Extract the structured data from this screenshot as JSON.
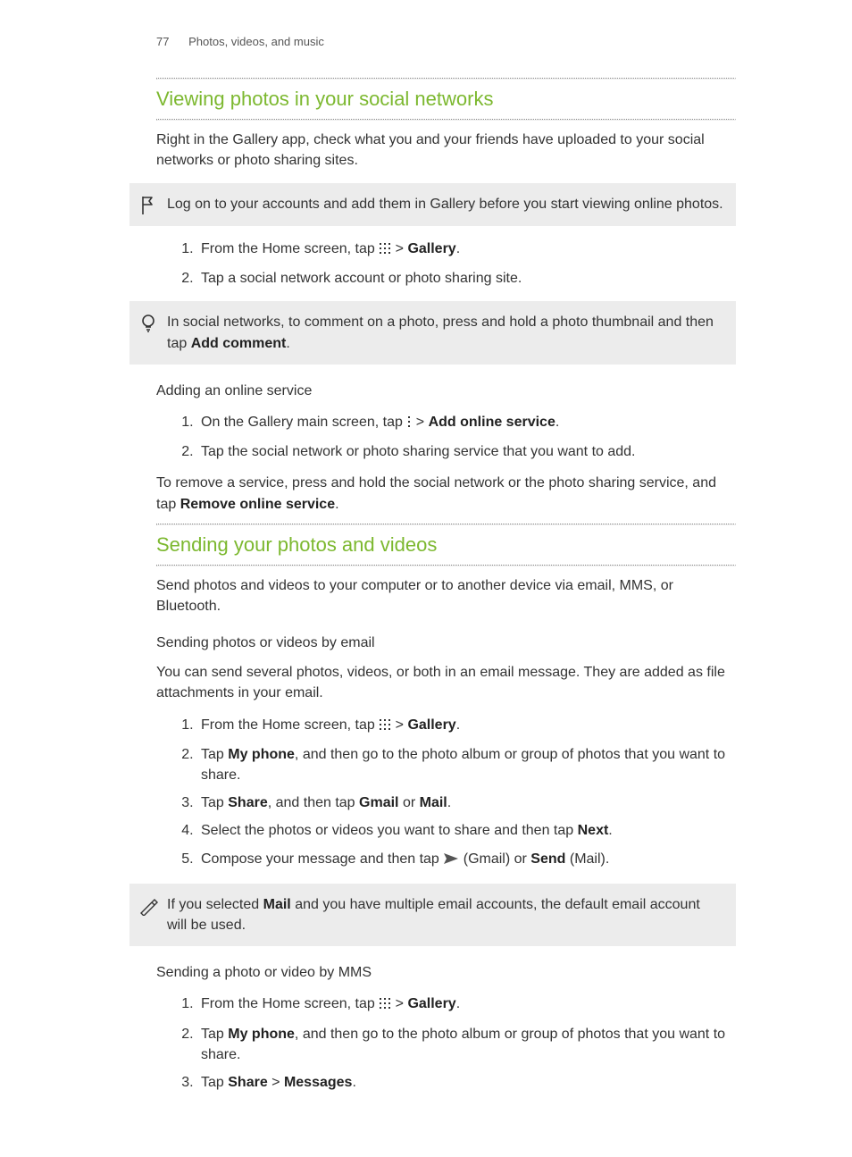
{
  "header": {
    "page_number": "77",
    "breadcrumb": "Photos, videos, and music"
  },
  "section1": {
    "title": "Viewing photos in your social networks",
    "intro": "Right in the Gallery app, check what you and your friends have uploaded to your social networks or photo sharing sites.",
    "callout_flag": "Log on to your accounts and add them in Gallery before you start viewing online photos.",
    "steps": {
      "s1_pre": "From the Home screen, tap ",
      "s1_gt": " > ",
      "s1_gallery": "Gallery",
      "s1_post": ".",
      "s2": "Tap a social network account or photo sharing site."
    },
    "callout_bulb_pre": "In social networks, to comment on a photo, press and hold a photo thumbnail and then tap ",
    "callout_bulb_bold": "Add comment",
    "callout_bulb_post": ".",
    "sub1_title": "Adding an online service",
    "sub1_steps": {
      "s1_pre": "On the Gallery main screen, tap ",
      "s1_gt": " > ",
      "s1_bold": "Add online service",
      "s1_post": ".",
      "s2": "Tap the social network or photo sharing service that you want to add."
    },
    "remove_pre": "To remove a service, press and hold the social network or the photo sharing service, and tap ",
    "remove_bold": "Remove online service",
    "remove_post": "."
  },
  "section2": {
    "title": "Sending your photos and videos",
    "intro": "Send photos and videos to your computer or to another device via email, MMS, or Bluetooth.",
    "sub_email_title": "Sending photos or videos by email",
    "sub_email_intro": "You can send several photos, videos, or both in an email message. They are added as file attachments in your email.",
    "email_steps": {
      "s1_pre": "From the Home screen, tap ",
      "s1_gt": " > ",
      "s1_gallery": "Gallery",
      "s1_post": ".",
      "s2_pre": "Tap ",
      "s2_bold": "My phone",
      "s2_post": ", and then go to the photo album or group of photos that you want to share.",
      "s3_pre": "Tap ",
      "s3_b1": "Share",
      "s3_mid": ", and then tap ",
      "s3_b2": "Gmail",
      "s3_or": " or ",
      "s3_b3": "Mail",
      "s3_post": ".",
      "s4_pre": "Select the photos or videos you want to share and then tap ",
      "s4_bold": "Next",
      "s4_post": ".",
      "s5_pre": "Compose your message and then tap ",
      "s5_mid": " (Gmail) or ",
      "s5_bold": "Send",
      "s5_post": " (Mail)."
    },
    "callout_pen_pre": "If you selected ",
    "callout_pen_bold": "Mail",
    "callout_pen_post": " and you have multiple email accounts, the default email account will be used.",
    "sub_mms_title": "Sending a photo or video by MMS",
    "mms_steps": {
      "s1_pre": "From the Home screen, tap ",
      "s1_gt": " > ",
      "s1_gallery": "Gallery",
      "s1_post": ".",
      "s2_pre": "Tap ",
      "s2_bold": "My phone",
      "s2_post": ", and then go to the photo album or group of photos that you want to share.",
      "s3_pre": "Tap ",
      "s3_b1": "Share",
      "s3_gt": " > ",
      "s3_b2": "Messages",
      "s3_post": "."
    }
  }
}
